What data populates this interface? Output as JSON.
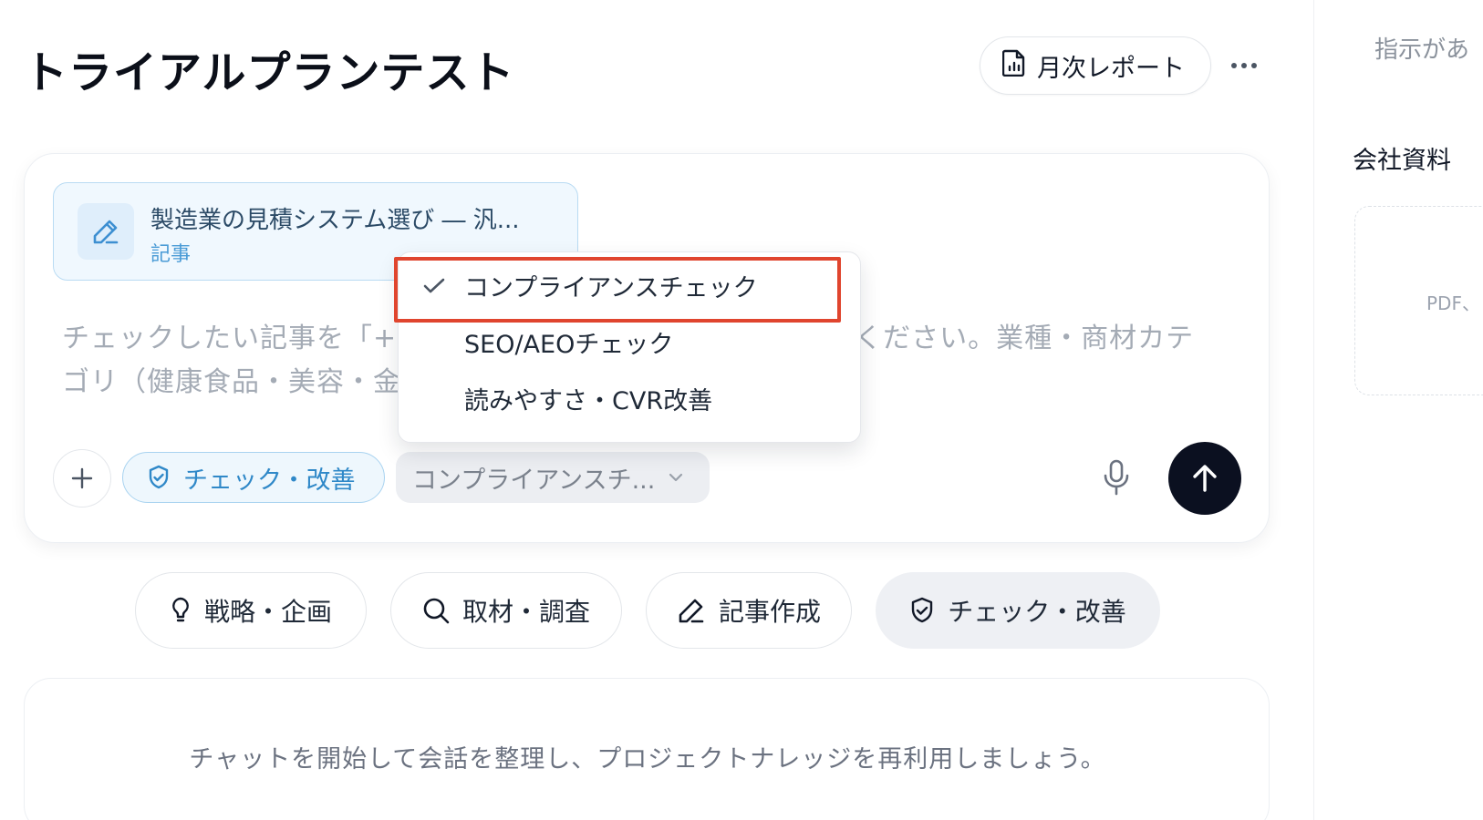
{
  "header": {
    "title": "トライアルプランテスト",
    "report_button_label": "月次レポート"
  },
  "composer": {
    "attachment": {
      "title": "製造業の見積システム選び ― 汎...",
      "type_label": "記事"
    },
    "placeholder_line1_left": "チェックしたい記事を「+",
    "placeholder_line1_right": "ください。業種・商材カテ",
    "placeholder_line2_left": "ゴリ（健康食品・美容・金",
    "mode_chip_label": "チェック・改善",
    "selected_check": "コンプライアンスチ...",
    "dropdown_options": [
      {
        "label": "コンプライアンスチェック",
        "selected": true
      },
      {
        "label": "SEO/AEOチェック",
        "selected": false
      },
      {
        "label": "読みやすさ・CVR改善",
        "selected": false
      }
    ]
  },
  "categories": [
    {
      "label": "戦略・企画",
      "icon": "lightbulb-icon",
      "active": false
    },
    {
      "label": "取材・調査",
      "icon": "search-icon",
      "active": false
    },
    {
      "label": "記事作成",
      "icon": "pen-icon",
      "active": false
    },
    {
      "label": "チェック・改善",
      "icon": "shield-check-icon",
      "active": true
    }
  ],
  "empty_state": {
    "message": "チャットを開始して会話を整理し、プロジェクトナレッジを再利用しましょう。"
  },
  "right_panel": {
    "hint": "指示があ",
    "section_title": "会社資料",
    "drop_hint": "PDF、"
  },
  "colors": {
    "accent_blue": "#2f88c8",
    "highlight_red": "#e0452e",
    "send_button": "#0b1020"
  }
}
